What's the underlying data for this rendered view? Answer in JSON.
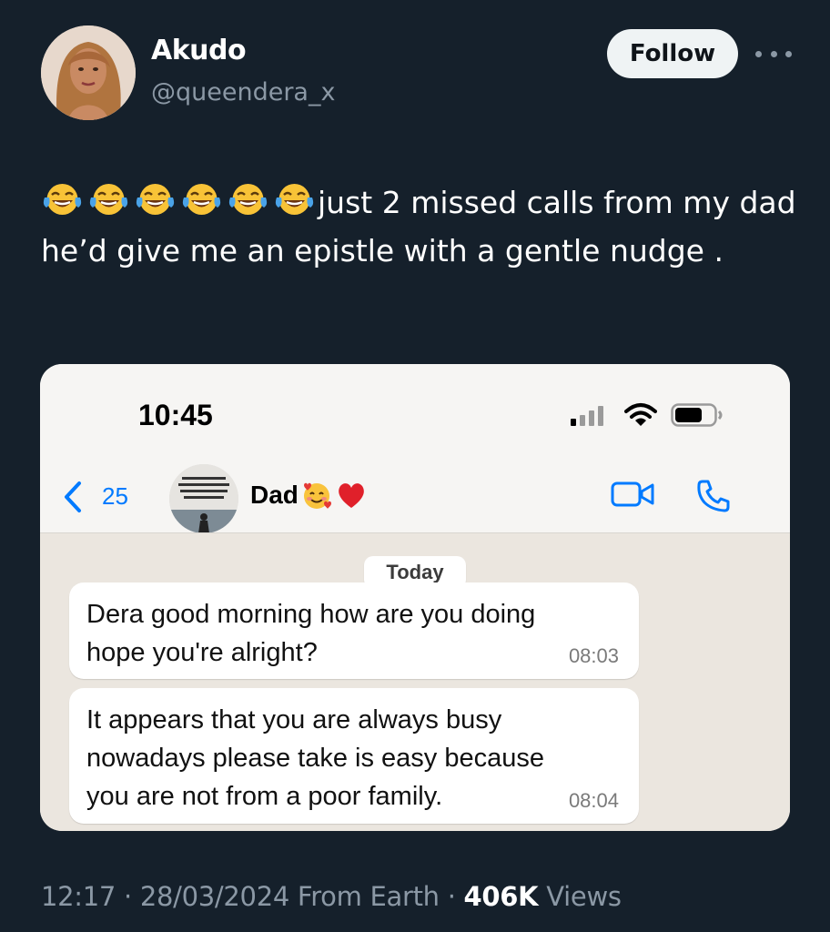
{
  "tweet": {
    "author": {
      "display_name": "Akudo",
      "handle": "@queendera_x"
    },
    "follow_label": "Follow",
    "emoji": [
      "face-with-tears-of-joy",
      "face-with-tears-of-joy",
      "face-with-tears-of-joy",
      "face-with-tears-of-joy",
      "face-with-tears-of-joy",
      "face-with-tears-of-joy"
    ],
    "text": "just 2 missed calls from my dad he’d give me an epistle with a gentle nudge .",
    "time": "12:17",
    "date": "28/03/2024",
    "source": "From Earth",
    "views_count": "406K",
    "views_label": "Views"
  },
  "screenshot": {
    "status_time": "10:45",
    "back_count": "25",
    "contact_name": "Dad",
    "contact_emoji": [
      "smiling-face-with-hearts",
      "red-heart"
    ],
    "date_chip": "Today",
    "messages": [
      {
        "text": "Dera  good morning how are you doing\nhope you're alright?",
        "time": "08:03"
      },
      {
        "text": "It appears that you are always busy\nnowadays  please  take is easy  because\nyou are not from a  poor family.",
        "time": "08:04"
      }
    ]
  },
  "colors": {
    "background": "#15202b",
    "secondary_text": "#8b98a5",
    "ios_blue": "#007aff",
    "chat_bg": "#ebe6df"
  }
}
